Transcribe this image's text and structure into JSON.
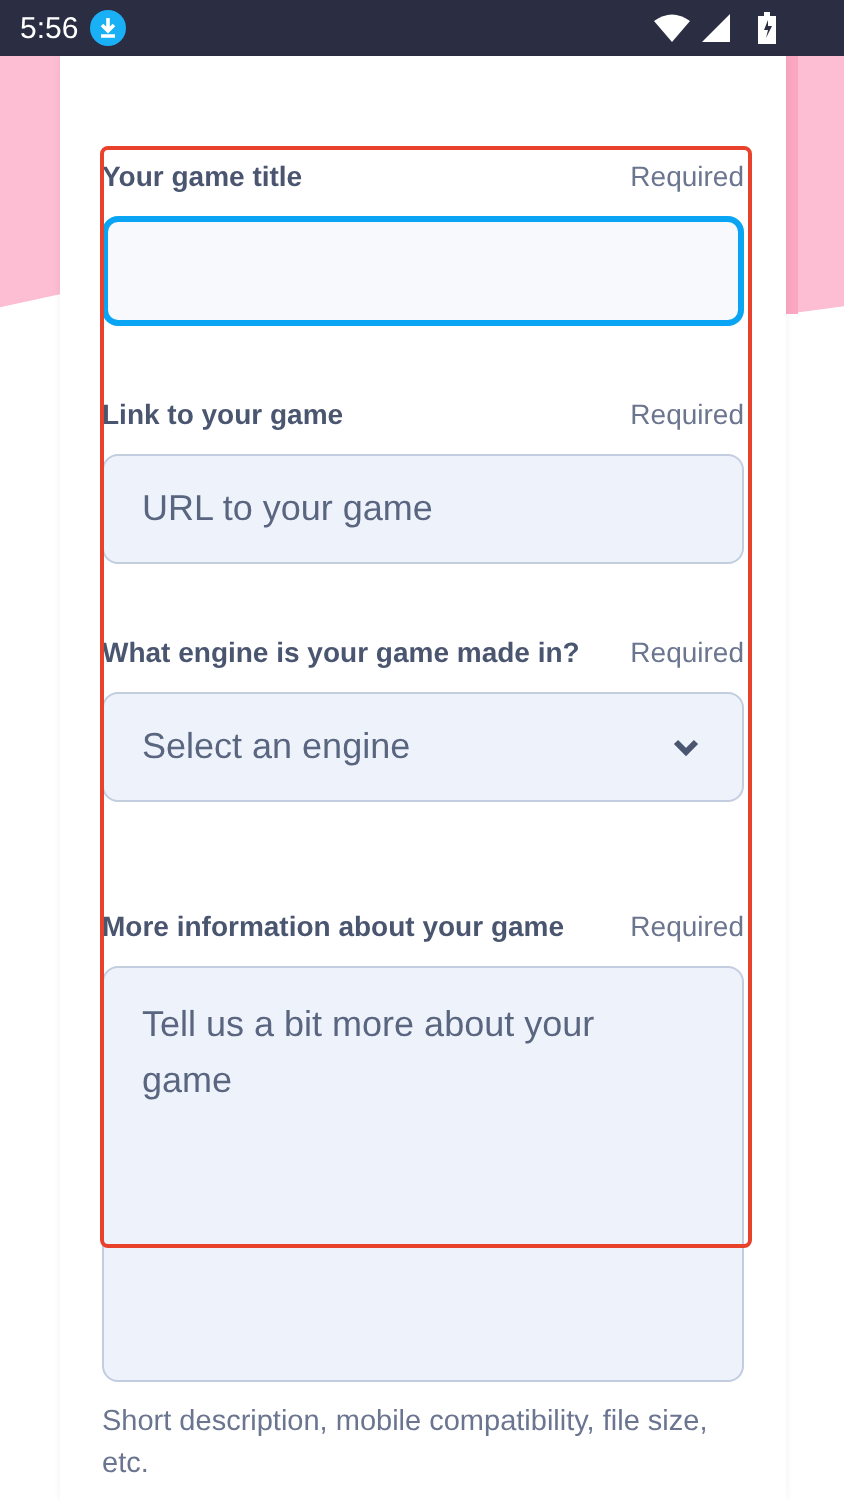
{
  "status_bar": {
    "time": "5:56"
  },
  "form": {
    "fields": [
      {
        "kind": "text",
        "label": "Your game title",
        "required_label": "Required",
        "focused": true
      },
      {
        "kind": "text",
        "label": "Link to your game",
        "required_label": "Required",
        "placeholder": "URL to your game",
        "focused": false
      },
      {
        "kind": "select",
        "label": "What engine is your game made in?",
        "required_label": "Required",
        "placeholder": "Select an engine",
        "focused": false
      },
      {
        "kind": "textarea",
        "label": "More information about your game",
        "required_label": "Required",
        "placeholder": "Tell us a bit more about your game",
        "focused": false,
        "hint": "Short description, mobile compatibility, file size, etc."
      }
    ]
  }
}
